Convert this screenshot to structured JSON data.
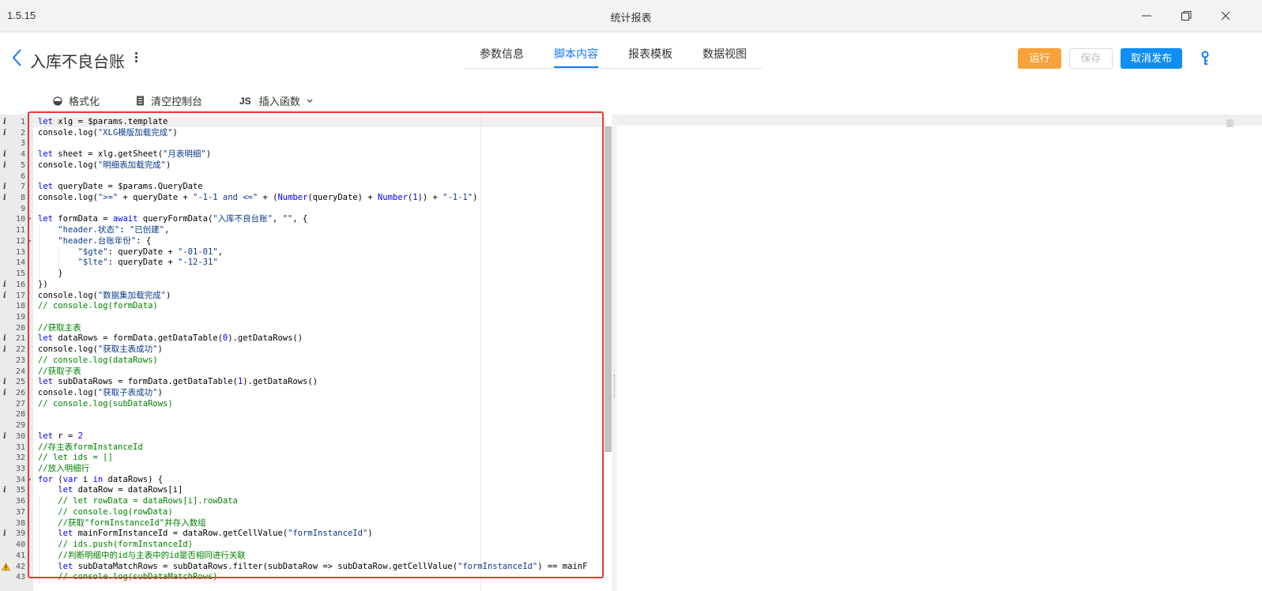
{
  "app": {
    "version": "1.5.15",
    "window_title": "统计报表"
  },
  "header": {
    "title": "入库不良台账"
  },
  "tabs": [
    {
      "label": "参数信息",
      "active": false
    },
    {
      "label": "脚本内容",
      "active": true
    },
    {
      "label": "报表模板",
      "active": false
    },
    {
      "label": "数据视图",
      "active": false
    }
  ],
  "actions": {
    "run": "运行",
    "save": "保存",
    "unpublish": "取消发布"
  },
  "toolbar": {
    "format": "格式化",
    "clear_console": "清空控制台",
    "js_badge": "JS",
    "insert_function": "插入函数"
  },
  "colors": {
    "accent": "#1677ff",
    "run": "#f7a33a",
    "unpublish": "#0f8ef5",
    "highlight_border": "#e53935"
  },
  "editor": {
    "lines": [
      {
        "n": "1",
        "info": true,
        "tokens": [
          [
            "kw",
            "let"
          ],
          [
            "pl",
            " xlg = $params.template"
          ]
        ]
      },
      {
        "n": "2",
        "info": true,
        "tokens": [
          [
            "pl",
            "console.log("
          ],
          [
            "str2",
            "\"XLG模版加载完成\""
          ],
          [
            "pl",
            ")"
          ]
        ]
      },
      {
        "n": "3",
        "tokens": []
      },
      {
        "n": "4",
        "info": true,
        "tokens": [
          [
            "kw",
            "let"
          ],
          [
            "pl",
            " sheet = xlg.getSheet("
          ],
          [
            "str2",
            "\"月表明细\""
          ],
          [
            "pl",
            ")"
          ]
        ]
      },
      {
        "n": "5",
        "info": true,
        "tokens": [
          [
            "pl",
            "console.log("
          ],
          [
            "str2",
            "\"明细表加载完成\""
          ],
          [
            "pl",
            ")"
          ]
        ]
      },
      {
        "n": "6",
        "tokens": []
      },
      {
        "n": "7",
        "info": true,
        "tokens": [
          [
            "kw",
            "let"
          ],
          [
            "pl",
            " queryDate = $params.QueryDate"
          ]
        ]
      },
      {
        "n": "8",
        "info": true,
        "tokens": [
          [
            "pl",
            "console.log("
          ],
          [
            "str2",
            "\">=\""
          ],
          [
            "pl",
            " + queryDate + "
          ],
          [
            "str2",
            "\"-1-1 and <=\""
          ],
          [
            "pl",
            " + ("
          ],
          [
            "kw",
            "Number"
          ],
          [
            "pl",
            "(queryDate) + "
          ],
          [
            "kw",
            "Number"
          ],
          [
            "pl",
            "("
          ],
          [
            "kw",
            "1"
          ],
          [
            "pl",
            ")) + "
          ],
          [
            "str2",
            "\"-1-1\""
          ],
          [
            "pl",
            ")"
          ]
        ]
      },
      {
        "n": "9",
        "tokens": []
      },
      {
        "n": "10",
        "fold": true,
        "tokens": [
          [
            "kw",
            "let"
          ],
          [
            "pl",
            " formData = "
          ],
          [
            "kw",
            "await"
          ],
          [
            "pl",
            " queryFormData("
          ],
          [
            "str2",
            "\"入库不良台账\""
          ],
          [
            "pl",
            ", "
          ],
          [
            "str2",
            "\"\""
          ],
          [
            "pl",
            ", {"
          ]
        ]
      },
      {
        "n": "11",
        "tokens": [
          [
            "pl",
            "    "
          ],
          [
            "str2",
            "\"header.状态\""
          ],
          [
            "pl",
            ": "
          ],
          [
            "str2",
            "\"已创建\""
          ],
          [
            "pl",
            ","
          ]
        ]
      },
      {
        "n": "12",
        "fold": true,
        "tokens": [
          [
            "pl",
            "    "
          ],
          [
            "str2",
            "\"header.台账年份\""
          ],
          [
            "pl",
            ": {"
          ]
        ]
      },
      {
        "n": "13",
        "tokens": [
          [
            "pl",
            "        "
          ],
          [
            "str2",
            "\"$gte\""
          ],
          [
            "pl",
            ": queryDate + "
          ],
          [
            "str2",
            "\"-01-01\""
          ],
          [
            "pl",
            ","
          ]
        ]
      },
      {
        "n": "14",
        "tokens": [
          [
            "pl",
            "        "
          ],
          [
            "str2",
            "\"$lte\""
          ],
          [
            "pl",
            ": queryDate + "
          ],
          [
            "str2",
            "\"-12-31\""
          ]
        ]
      },
      {
        "n": "15",
        "tokens": [
          [
            "pl",
            "    }"
          ]
        ]
      },
      {
        "n": "16",
        "info": true,
        "tokens": [
          [
            "pl",
            "})"
          ]
        ]
      },
      {
        "n": "17",
        "info": true,
        "tokens": [
          [
            "pl",
            "console.log("
          ],
          [
            "str2",
            "\"数据集加载完成\""
          ],
          [
            "pl",
            ")"
          ]
        ]
      },
      {
        "n": "18",
        "tokens": [
          [
            "cm",
            "// console.log(formData)"
          ]
        ]
      },
      {
        "n": "19",
        "tokens": []
      },
      {
        "n": "20",
        "tokens": [
          [
            "cm",
            "//获取主表"
          ]
        ]
      },
      {
        "n": "21",
        "info": true,
        "tokens": [
          [
            "kw",
            "let"
          ],
          [
            "pl",
            " dataRows = formData.getDataTable("
          ],
          [
            "kw",
            "0"
          ],
          [
            "pl",
            ").getDataRows()"
          ]
        ]
      },
      {
        "n": "22",
        "info": true,
        "tokens": [
          [
            "pl",
            "console.log("
          ],
          [
            "str2",
            "\"获取主表成功\""
          ],
          [
            "pl",
            ")"
          ]
        ]
      },
      {
        "n": "23",
        "tokens": [
          [
            "cm",
            "// console.log(dataRows)"
          ]
        ]
      },
      {
        "n": "24",
        "tokens": [
          [
            "cm",
            "//获取子表"
          ]
        ]
      },
      {
        "n": "25",
        "info": true,
        "tokens": [
          [
            "kw",
            "let"
          ],
          [
            "pl",
            " subDataRows = formData.getDataTable("
          ],
          [
            "kw",
            "1"
          ],
          [
            "pl",
            ").getDataRows()"
          ]
        ]
      },
      {
        "n": "26",
        "info": true,
        "tokens": [
          [
            "pl",
            "console.log("
          ],
          [
            "str2",
            "\"获取子表成功\""
          ],
          [
            "pl",
            ")"
          ]
        ]
      },
      {
        "n": "27",
        "tokens": [
          [
            "cm",
            "// console.log(subDataRows)"
          ]
        ]
      },
      {
        "n": "28",
        "tokens": []
      },
      {
        "n": "29",
        "tokens": []
      },
      {
        "n": "30",
        "info": true,
        "tokens": [
          [
            "kw",
            "let"
          ],
          [
            "pl",
            " r = "
          ],
          [
            "kw",
            "2"
          ]
        ]
      },
      {
        "n": "31",
        "tokens": [
          [
            "cm",
            "//存主表formInstanceId"
          ]
        ]
      },
      {
        "n": "32",
        "tokens": [
          [
            "cm",
            "// let ids = []"
          ]
        ]
      },
      {
        "n": "33",
        "tokens": [
          [
            "cm",
            "//放入明细行"
          ]
        ]
      },
      {
        "n": "34",
        "fold": true,
        "tokens": [
          [
            "kw",
            "for"
          ],
          [
            "pl",
            " ("
          ],
          [
            "kw",
            "var"
          ],
          [
            "pl",
            " i "
          ],
          [
            "kw",
            "in"
          ],
          [
            "pl",
            " dataRows) {"
          ]
        ]
      },
      {
        "n": "35",
        "info": true,
        "tokens": [
          [
            "pl",
            "    "
          ],
          [
            "kw",
            "let"
          ],
          [
            "pl",
            " dataRow = dataRows[i]"
          ]
        ]
      },
      {
        "n": "36",
        "tokens": [
          [
            "pl",
            "    "
          ],
          [
            "cm",
            "// let rowData = dataRows[i].rowData"
          ]
        ]
      },
      {
        "n": "37",
        "tokens": [
          [
            "pl",
            "    "
          ],
          [
            "cm",
            "// console.log(rowData)"
          ]
        ]
      },
      {
        "n": "38",
        "tokens": [
          [
            "pl",
            "    "
          ],
          [
            "cm",
            "//获取\"formInstanceId\"并存入数组"
          ]
        ]
      },
      {
        "n": "39",
        "info": true,
        "tokens": [
          [
            "pl",
            "    "
          ],
          [
            "kw",
            "let"
          ],
          [
            "pl",
            " mainFormInstanceId = dataRow.getCellValue("
          ],
          [
            "str2",
            "\"formInstanceId\""
          ],
          [
            "pl",
            ")"
          ]
        ]
      },
      {
        "n": "40",
        "tokens": [
          [
            "pl",
            "    "
          ],
          [
            "cm",
            "// ids.push(formInstanceId)"
          ]
        ]
      },
      {
        "n": "41",
        "tokens": [
          [
            "pl",
            "    "
          ],
          [
            "cm",
            "//判断明细中的id与主表中的id是否相同进行关联"
          ]
        ]
      },
      {
        "n": "42",
        "warn": true,
        "tokens": [
          [
            "pl",
            "    "
          ],
          [
            "kw",
            "let"
          ],
          [
            "pl",
            " subDataMatchRows = subDataRows.filter(subDataRow => subDataRow.getCellValue("
          ],
          [
            "str2",
            "\"formInstanceId\""
          ],
          [
            "pl",
            ") == mainF"
          ]
        ]
      },
      {
        "n": "43",
        "tokens": [
          [
            "pl",
            "    "
          ],
          [
            "cm",
            "// console.log(subDataMatchRows)"
          ]
        ]
      }
    ]
  }
}
